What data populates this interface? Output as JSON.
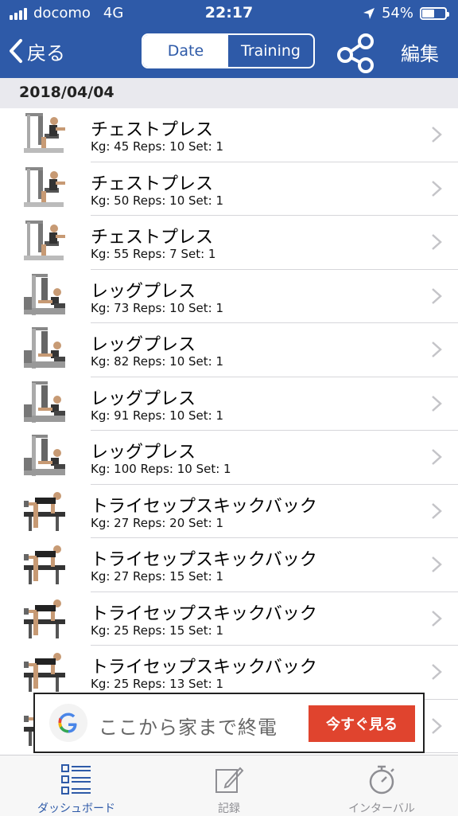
{
  "status_bar": {
    "carrier": "docomo",
    "network": "4G",
    "time": "22:17",
    "battery": "54%",
    "battery_level": 0.54
  },
  "nav": {
    "back_label": "戻る",
    "segments": [
      "Date",
      "Training"
    ],
    "active_segment": "Date",
    "share_icon": "share-icon",
    "edit_label": "編集"
  },
  "section_header": "2018/04/04",
  "entries": [
    {
      "name": "チェストプレス",
      "detail": "Kg: 45 Reps: 10 Set: 1",
      "icon": "chest-press-machine"
    },
    {
      "name": "チェストプレス",
      "detail": "Kg: 50 Reps: 10 Set: 1",
      "icon": "chest-press-machine"
    },
    {
      "name": "チェストプレス",
      "detail": "Kg: 55 Reps: 7 Set: 1",
      "icon": "chest-press-machine"
    },
    {
      "name": "レッグプレス",
      "detail": "Kg: 73 Reps: 10 Set: 1",
      "icon": "leg-press-machine"
    },
    {
      "name": "レッグプレス",
      "detail": "Kg: 82 Reps: 10 Set: 1",
      "icon": "leg-press-machine"
    },
    {
      "name": "レッグプレス",
      "detail": "Kg: 91 Reps: 10 Set: 1",
      "icon": "leg-press-machine"
    },
    {
      "name": "レッグプレス",
      "detail": "Kg: 100 Reps: 10 Set: 1",
      "icon": "leg-press-machine"
    },
    {
      "name": "トライセップスキックバック",
      "detail": "Kg: 27 Reps: 20 Set: 1",
      "icon": "triceps-kickback"
    },
    {
      "name": "トライセップスキックバック",
      "detail": "Kg: 27 Reps: 15 Set: 1",
      "icon": "triceps-kickback"
    },
    {
      "name": "トライセップスキックバック",
      "detail": "Kg: 25 Reps: 15 Set: 1",
      "icon": "triceps-kickback"
    },
    {
      "name": "トライセップスキックバック",
      "detail": "Kg: 25 Reps: 13 Set: 1",
      "icon": "triceps-kickback"
    },
    {
      "name": "",
      "detail": "",
      "icon": "triceps-kickback"
    }
  ],
  "ad": {
    "text": "ここから家まで終電",
    "button_label": "今すぐ見る",
    "logo": "google-g-logo"
  },
  "tabbar": {
    "items": [
      {
        "label": "ダッシュボード",
        "icon": "dashboard-icon",
        "active": true
      },
      {
        "label": "記録",
        "icon": "edit-record-icon",
        "active": false
      },
      {
        "label": "インターバル",
        "icon": "stopwatch-icon",
        "active": false
      }
    ]
  },
  "colors": {
    "nav_blue": "#2e5aa8",
    "ad_button": "#e0442e",
    "section_bg": "#e9e9ee",
    "tab_inactive": "#8e8e93"
  }
}
